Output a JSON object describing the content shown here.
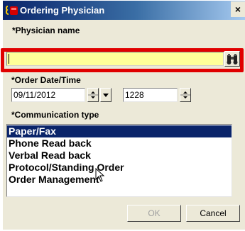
{
  "window": {
    "title": "Ordering Physician",
    "close_label": "×"
  },
  "physician": {
    "label": "*Physician name",
    "value": ""
  },
  "order": {
    "label": "*Order Date/Time",
    "date": "09/11/2012",
    "time": "1228"
  },
  "communication": {
    "label": "*Communication type",
    "items": [
      {
        "label": "Paper/Fax",
        "selected": true
      },
      {
        "label": "Phone Read back"
      },
      {
        "label": "Verbal Read back"
      },
      {
        "label": "Protocol/Standing Order"
      },
      {
        "label": "Order Management"
      }
    ]
  },
  "buttons": {
    "ok": "OK",
    "cancel": "Cancel"
  },
  "colors": {
    "highlight": "#e00000",
    "input_bg": "#ffff99",
    "selection": "#0a246a"
  }
}
